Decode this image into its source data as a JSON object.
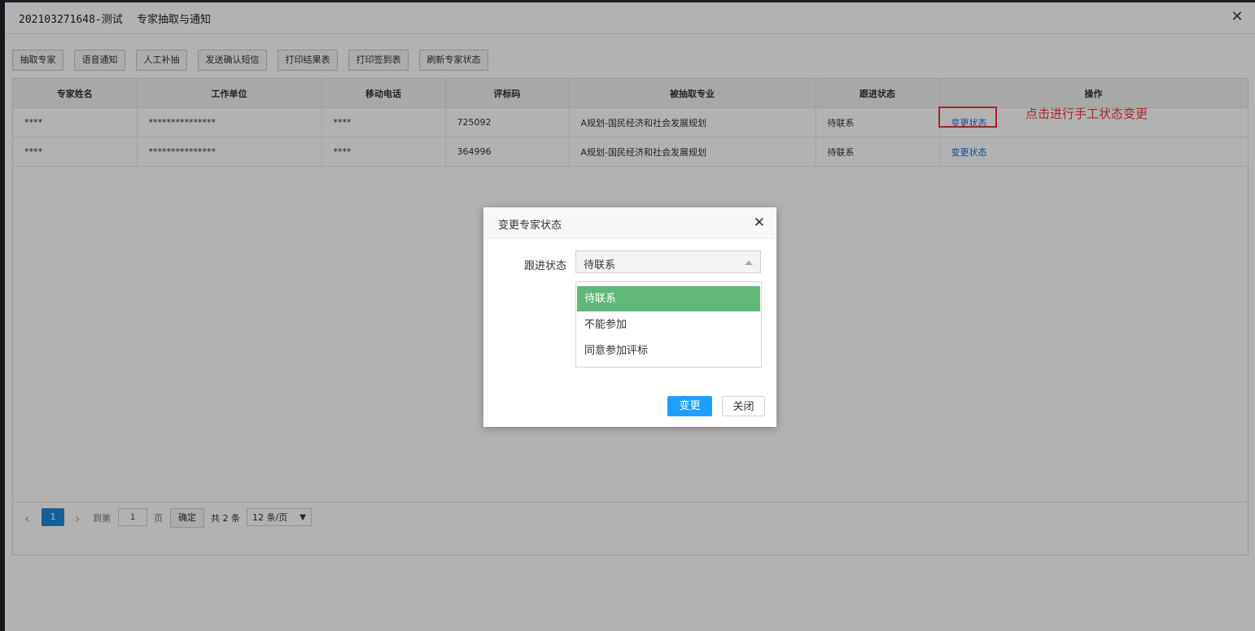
{
  "window": {
    "title_id": "202103271648-测试",
    "title_text": "专家抽取与通知",
    "close_icon": "close-icon"
  },
  "toolbar": {
    "buttons": [
      "抽取专家",
      "语音通知",
      "人工补抽",
      "发送确认短信",
      "打印结果表",
      "打印签到表",
      "刷新专家状态"
    ]
  },
  "table": {
    "headers": [
      "专家姓名",
      "工作单位",
      "移动电话",
      "评标码",
      "被抽取专业",
      "跟进状态",
      "操作"
    ],
    "rows": [
      [
        "****",
        "***************",
        "****",
        "725092",
        "A规划-国民经济和社会发展规划",
        "待联系",
        "变更状态"
      ],
      [
        "****",
        "***************",
        "****",
        "364996",
        "A规划-国民经济和社会发展规划",
        "待联系",
        "变更状态"
      ]
    ]
  },
  "annotation": {
    "text": "点击进行手工状态变更",
    "color": "#f03c3c"
  },
  "pager": {
    "current_page": "1",
    "goto_label": "到第",
    "goto_value": "1",
    "page_unit": "页",
    "confirm_label": "确定",
    "total_label": "共 2 条",
    "page_size": "12 条/页"
  },
  "dialog": {
    "title": "变更专家状态",
    "field_label": "跟进状态",
    "selected_value": "待联系",
    "options": [
      "待联系",
      "不能参加",
      "同意参加评标"
    ],
    "selected_color": "#5fb878",
    "confirm_label": "变更",
    "close_label": "关闭",
    "primary_color": "#1e9fff"
  }
}
